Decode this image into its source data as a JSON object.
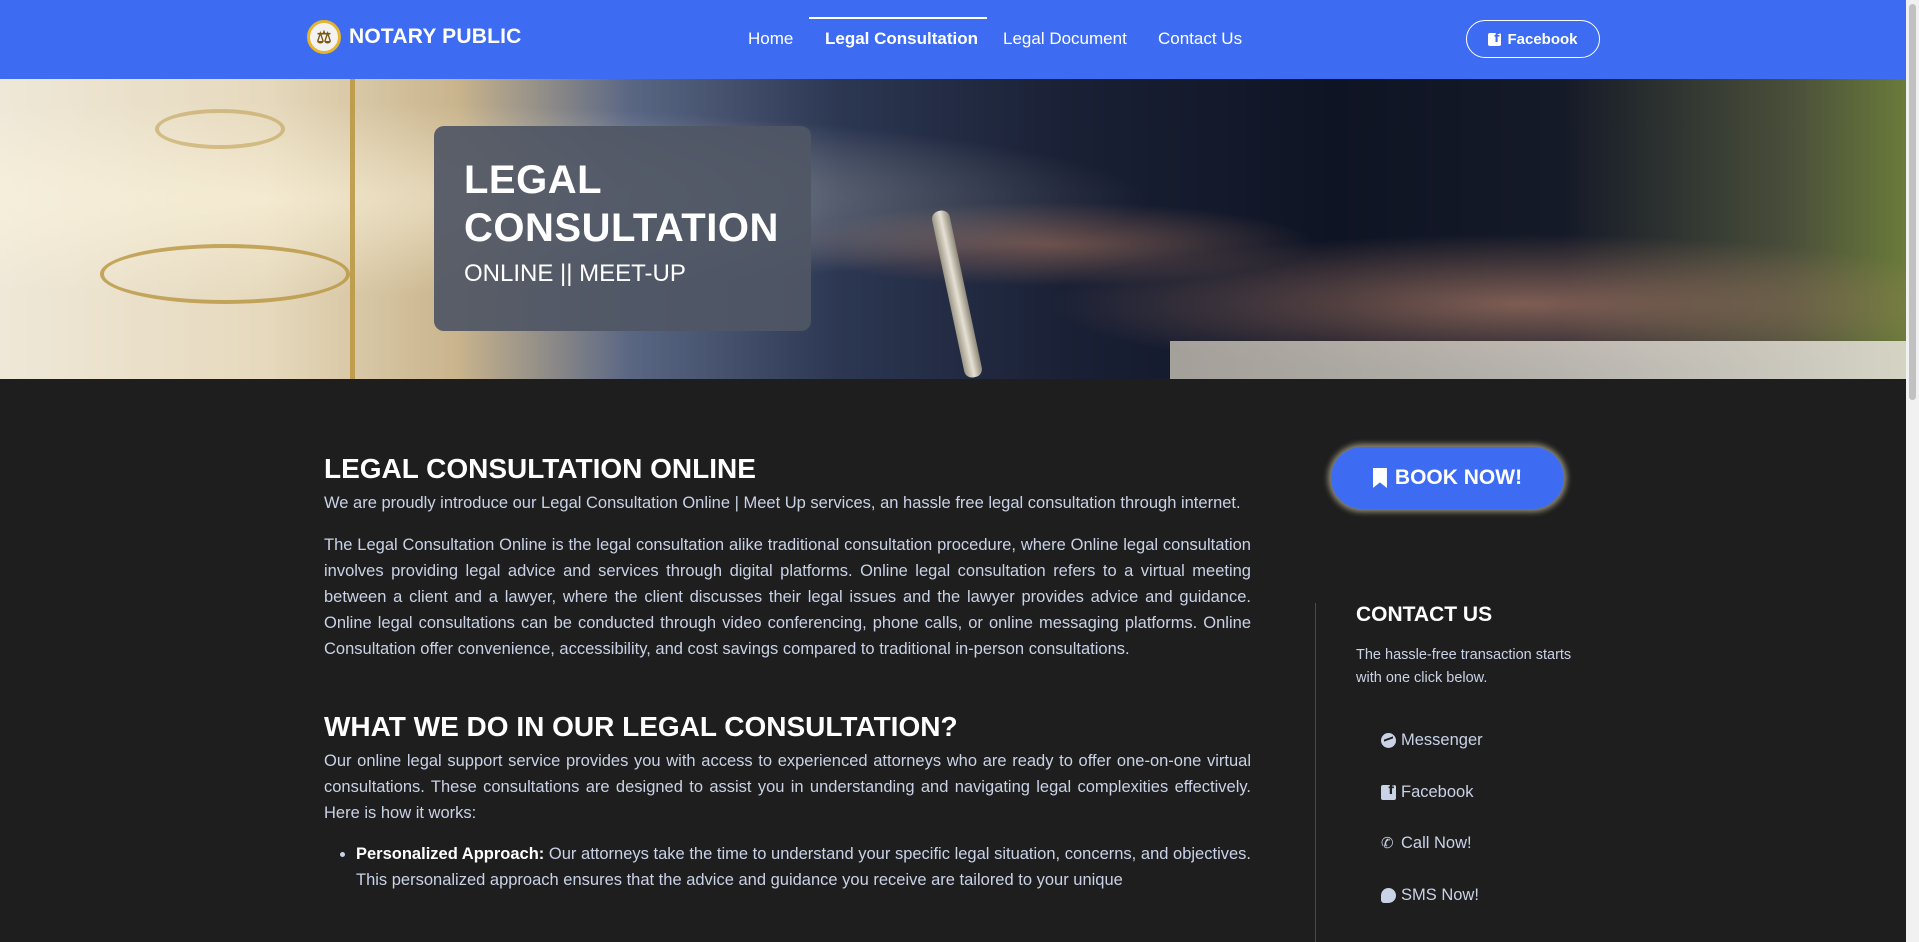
{
  "brand": {
    "name": "NOTARY PUBLIC",
    "logo_glyph": "⚖"
  },
  "nav": {
    "items": [
      {
        "label": "Home"
      },
      {
        "label": "Legal Consultation"
      },
      {
        "label": "Legal Document"
      },
      {
        "label": "Contact Us"
      }
    ],
    "active_index": 1,
    "facebook_label": "Facebook"
  },
  "hero": {
    "title": "LEGAL CONSULTATION",
    "subtitle": "ONLINE || MEET-UP"
  },
  "main": {
    "heading1": "LEGAL CONSULTATION ONLINE",
    "para1": "We are proudly introduce our Legal Consultation Online | Meet Up services, an hassle free legal consultation through internet.",
    "para2": "The Legal Consultation Online is the legal consultation alike traditional consultation procedure, where Online legal consultation involves providing legal advice and services through digital platforms. Online legal consultation refers to a virtual meeting between a client and a lawyer, where the client discusses their legal issues and the lawyer provides advice and guidance. Online legal consultations can be conducted through video conferencing, phone calls, or online messaging platforms. Online Consultation offer convenience, accessibility, and cost savings compared to traditional in-person consultations.",
    "heading2": "WHAT WE DO IN OUR LEGAL CONSULTATION?",
    "para3": "Our online legal support service provides you with access to experienced attorneys who are ready to offer one-on-one virtual consultations. These consultations are designed to assist you in understanding and navigating legal complexities effectively. Here is how it works:",
    "list": [
      {
        "label": "Personalized Approach:",
        "text": " Our attorneys take the time to understand your specific legal situation, concerns, and objectives. This personalized approach ensures that the advice and guidance you receive are tailored to your unique"
      }
    ]
  },
  "sidebar": {
    "book_label": "BOOK NOW!",
    "contact_title": "CONTACT US",
    "contact_desc": "The hassle-free transaction starts with one click below.",
    "contacts": [
      {
        "label": "Messenger",
        "icon": "messenger-icon"
      },
      {
        "label": "Facebook",
        "icon": "facebook-icon"
      },
      {
        "label": "Call Now!",
        "icon": "phone-icon"
      },
      {
        "label": "SMS Now!",
        "icon": "sms-icon"
      }
    ]
  },
  "colors": {
    "primary": "#3d6cf2",
    "background": "#1e1e1e",
    "body_text": "#c9d2e6",
    "heading_text": "#ffffff"
  }
}
